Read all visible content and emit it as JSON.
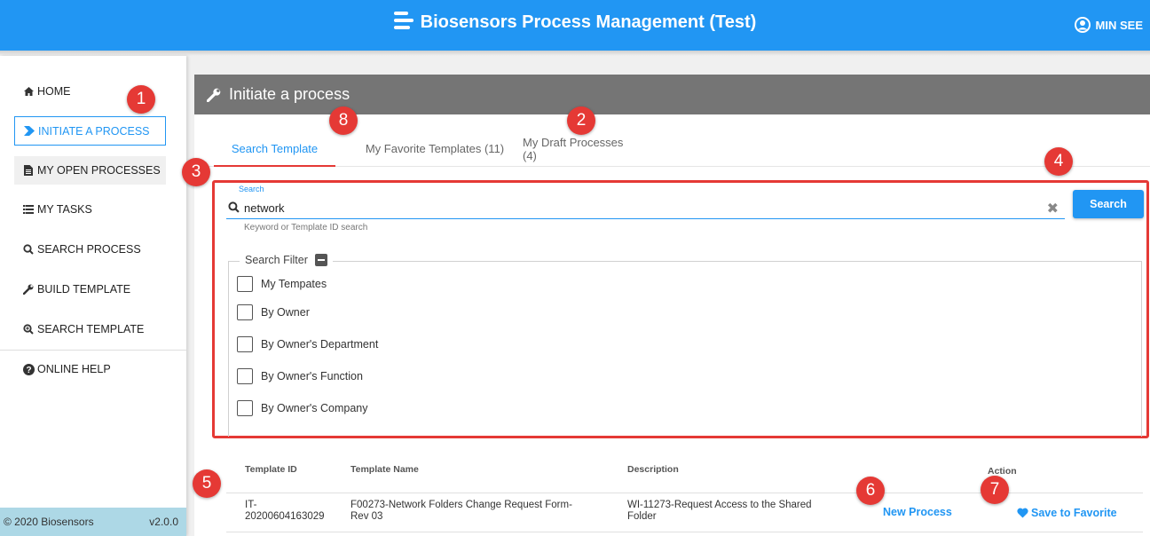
{
  "header": {
    "title": "Biosensors Process Management (Test)",
    "user": "MIN SEE"
  },
  "sidebar": {
    "items": [
      {
        "label": "HOME",
        "icon": "home-icon"
      },
      {
        "label": "INITIATE A PROCESS",
        "icon": "chevron-right-icon"
      },
      {
        "label": "MY OPEN PROCESSES",
        "icon": "file-icon"
      },
      {
        "label": "MY TASKS",
        "icon": "tasks-icon"
      },
      {
        "label": "SEARCH PROCESS",
        "icon": "search-icon"
      },
      {
        "label": "BUILD TEMPLATE",
        "icon": "wrench-icon"
      },
      {
        "label": "SEARCH TEMPLATE",
        "icon": "search-plus-icon"
      },
      {
        "label": "ONLINE HELP",
        "icon": "help-icon"
      }
    ],
    "copyright": "© 2020 Biosensors",
    "version": "v2.0.0"
  },
  "panel": {
    "title": "Initiate a process"
  },
  "tabs": [
    {
      "label": "Search Template"
    },
    {
      "label": "My Favorite Templates (11)"
    },
    {
      "label": "My Draft Processes (4)"
    }
  ],
  "search": {
    "label": "Search",
    "value": "network",
    "hint": "Keyword or Template ID search",
    "button": "Search"
  },
  "filter": {
    "legend": "Search Filter",
    "options": [
      "My Tempates",
      "By Owner",
      "By Owner's Department",
      "By Owner's Function",
      "By Owner's Company"
    ]
  },
  "table": {
    "headers": [
      "Template ID",
      "Template Name",
      "Description",
      "Action"
    ],
    "rows": [
      {
        "id_line1": "IT-",
        "id_line2": "20200604163029",
        "name_line1": "F00273-Network Folders Change Request Form-",
        "name_line2": "Rev 03",
        "desc_line1": "WI-11273-Request Access to the Shared",
        "desc_line2": "Folder",
        "new_process": "New Process",
        "save_favorite": "Save to Favorite"
      }
    ]
  },
  "annotations": [
    "1",
    "2",
    "3",
    "4",
    "5",
    "6",
    "7",
    "8"
  ],
  "colors": {
    "primary": "#2196f3",
    "annotation": "#e53935",
    "panel_header": "#757575"
  }
}
